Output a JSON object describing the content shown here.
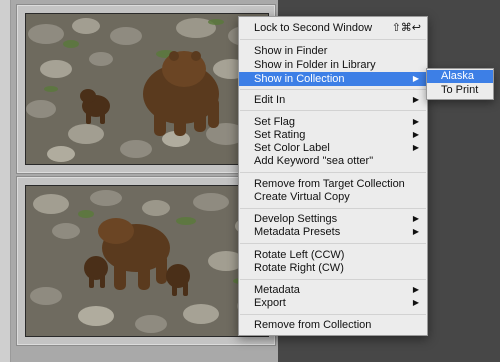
{
  "grid": {
    "photos": [
      {
        "alt": "bear-photo-top"
      },
      {
        "alt": "bear-photo-bottom"
      }
    ]
  },
  "menu": {
    "lock_second_window": "Lock to Second Window",
    "lock_shortcut": "⇧⌘↩",
    "show_in_finder": "Show in Finder",
    "show_in_folder": "Show in Folder in Library",
    "show_in_collection": "Show in Collection",
    "edit_in": "Edit In",
    "set_flag": "Set Flag",
    "set_rating": "Set Rating",
    "set_color_label": "Set Color Label",
    "add_keyword": "Add Keyword \"sea otter\"",
    "remove_from_target": "Remove from Target Collection",
    "create_virtual_copy": "Create Virtual Copy",
    "develop_settings": "Develop Settings",
    "metadata_presets": "Metadata Presets",
    "rotate_left": "Rotate Left (CCW)",
    "rotate_right": "Rotate Right (CW)",
    "metadata": "Metadata",
    "export": "Export",
    "remove_from_collection": "Remove from Collection"
  },
  "submenu": {
    "alaska": "Alaska",
    "to_print": "To Print"
  },
  "colors": {
    "highlight": "#3d7fe6",
    "menu_bg": "#ececec"
  }
}
